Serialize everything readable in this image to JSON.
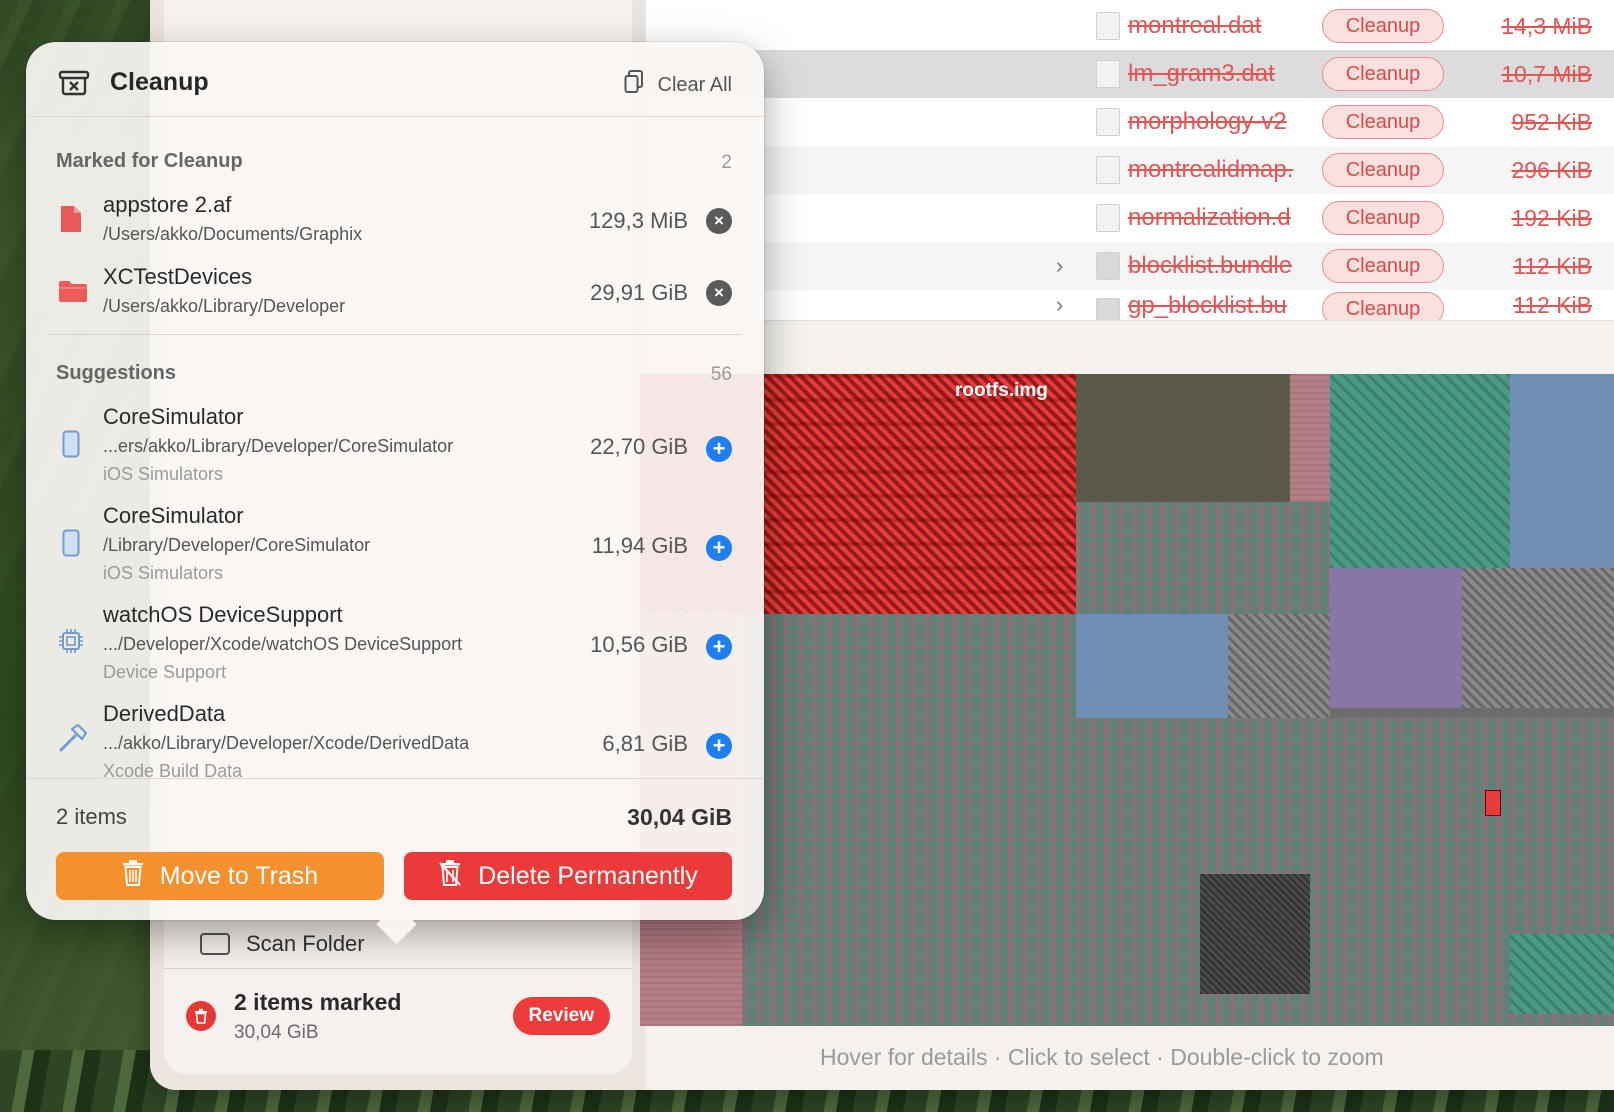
{
  "app": {
    "marked_summary": {
      "title": "2 items marked",
      "size": "30,04 GiB",
      "review_label": "Review"
    },
    "scan_folder_label": "Scan Folder",
    "status_hint": "Hover for details · Click to select · Double-click to zoom"
  },
  "file_list": {
    "rows": [
      {
        "name": "montreal.dat",
        "badge": "Cleanup",
        "size": "14,3 MiB",
        "kind": "file",
        "expandable": false
      },
      {
        "name": "lm_gram3.dat",
        "badge": "Cleanup",
        "size": "10,7 MiB",
        "kind": "file",
        "expandable": false,
        "selected": true
      },
      {
        "name": "morphology-v2",
        "badge": "Cleanup",
        "size": "952 KiB",
        "kind": "file",
        "expandable": false
      },
      {
        "name": "montrealidmap.",
        "badge": "Cleanup",
        "size": "296 KiB",
        "kind": "file",
        "expandable": false
      },
      {
        "name": "normalization.d",
        "badge": "Cleanup",
        "size": "192 KiB",
        "kind": "file",
        "expandable": false
      },
      {
        "name": "blocklist.bundle",
        "badge": "Cleanup",
        "size": "112 KiB",
        "kind": "bundle",
        "expandable": true
      },
      {
        "name": "gp_blocklist.bu",
        "badge": "Cleanup",
        "size": "112 KiB",
        "kind": "bundle",
        "expandable": true
      }
    ]
  },
  "treemap": {
    "highlight_label": "rootfs.img",
    "colors": {
      "marked": "#e83c3c",
      "teal": "#4a9a86",
      "purple": "#8a76a6",
      "blue": "#6f8fb5",
      "pink": "#b57d86",
      "gray": "#8a8a8a"
    }
  },
  "popover": {
    "title": "Cleanup",
    "clear_all_label": "Clear All",
    "marked_section": {
      "title": "Marked for Cleanup",
      "count": "2",
      "items": [
        {
          "name": "appstore 2.af",
          "path": "/Users/akko/Documents/Graphix",
          "size": "129,3 MiB",
          "icon": "document-icon",
          "action": "remove"
        },
        {
          "name": "XCTestDevices",
          "path": "/Users/akko/Library/Developer",
          "size": "29,91 GiB",
          "icon": "folder-icon",
          "action": "remove"
        }
      ]
    },
    "suggestions_section": {
      "title": "Suggestions",
      "count": "56",
      "items": [
        {
          "name": "CoreSimulator",
          "path": "...ers/akko/Library/Developer/CoreSimulator",
          "category": "iOS Simulators",
          "size": "22,70 GiB",
          "icon": "iphone-icon"
        },
        {
          "name": "CoreSimulator",
          "path": "/Library/Developer/CoreSimulator",
          "category": "iOS Simulators",
          "size": "11,94 GiB",
          "icon": "iphone-icon"
        },
        {
          "name": "watchOS DeviceSupport",
          "path": ".../Developer/Xcode/watchOS DeviceSupport",
          "category": "Device Support",
          "size": "10,56 GiB",
          "icon": "chip-icon"
        },
        {
          "name": "DerivedData",
          "path": ".../akko/Library/Developer/Xcode/DerivedData",
          "category": "Xcode Build Data",
          "size": "6,81 GiB",
          "icon": "hammer-icon"
        }
      ]
    },
    "footer": {
      "items_count": "2 items",
      "total_size": "30,04 GiB",
      "move_to_trash_label": "Move to Trash",
      "delete_permanently_label": "Delete Permanently"
    },
    "colors": {
      "trash_button": "#f5902e",
      "delete_button": "#ec3a3a",
      "add_button": "#1f7ef0",
      "strike_text": "#e05656"
    }
  }
}
